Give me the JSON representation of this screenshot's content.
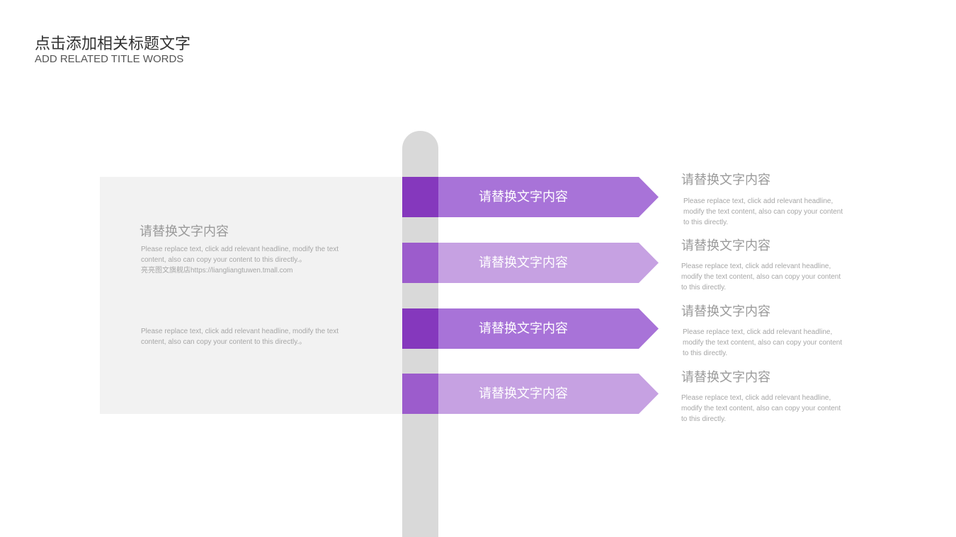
{
  "header": {
    "title_zh": "点击添加相关标题文字",
    "title_en": "ADD RELATED TITLE  WORDS"
  },
  "panel": {
    "heading": "请替换文字内容",
    "text1_line1": "Please replace text, click add relevant headline, modify the text",
    "text1_line2": "content, also can copy your content to this directly.。",
    "text1_line3": "亮亮图文旗舰店https://liangliangtuwen.tmall.com",
    "text2_line1": "Please replace text, click add relevant headline, modify the text",
    "text2_line2": "content, also can copy your content to this directly.。"
  },
  "signs": [
    {
      "label": "请替换文字内容"
    },
    {
      "label": "请替换文字内容"
    },
    {
      "label": "请替换文字内容"
    },
    {
      "label": "请替换文字内容"
    }
  ],
  "details": [
    {
      "heading": "请替换文字内容",
      "line1": "Please replace text, click add relevant headline,",
      "line2": "modify the text content, also can copy your content",
      "line3": "to this directly."
    },
    {
      "heading": "请替换文字内容",
      "line1": "Please replace text, click add relevant headline,",
      "line2": "modify the text content, also can copy your content",
      "line3": "to this directly."
    },
    {
      "heading": "请替换文字内容",
      "line1": "Please replace text, click add relevant headline,",
      "line2": "modify the text content, also can copy your content",
      "line3": "to this directly."
    },
    {
      "heading": "请替换文字内容",
      "line1": "Please replace text, click add relevant headline,",
      "line2": "modify the text content, also can copy your content",
      "line3": "to this directly."
    }
  ],
  "colors": {
    "accent_dark": "#8538bd",
    "accent_mid": "#a873d8",
    "accent_light": "#c6a1e2",
    "pole": "#d9d9d9",
    "panel": "#f2f2f2"
  }
}
